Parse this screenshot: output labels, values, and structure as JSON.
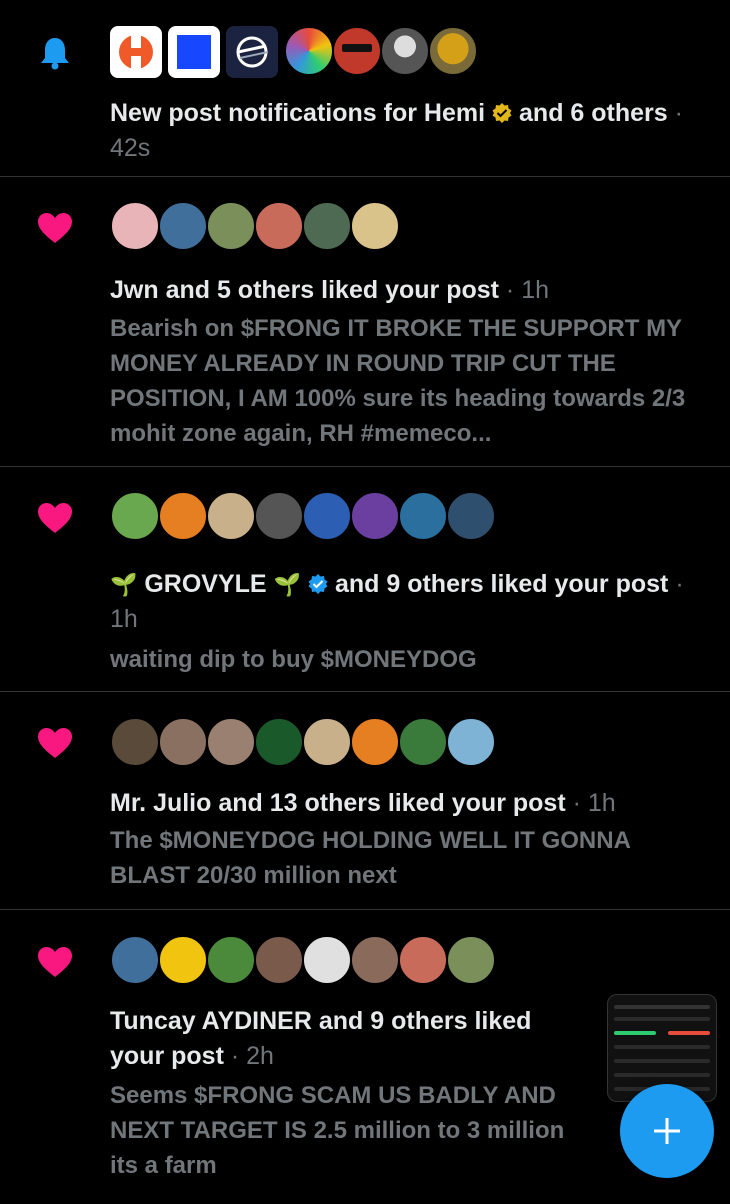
{
  "notifications": [
    {
      "type": "new_post",
      "icon": "bell-icon",
      "text_before": "New post notifications for Hemi",
      "text_after": "and 6 others",
      "time": "42s",
      "avatar_colors": [
        "#f05a28",
        "#1747ff",
        "#1c2340",
        "#9b4dca",
        "#c0392b",
        "#555555",
        "#d4a017"
      ]
    },
    {
      "type": "like",
      "icon": "heart-icon",
      "title": "Jwn and 5 others liked your post",
      "time": "1h",
      "body": "Bearish on $FRONG IT BROKE THE SUPPORT MY MONEY ALREADY IN ROUND TRIP CUT THE POSITION, I AM 100% sure its heading towards 2/3 mohit zone again, RH #memeco...",
      "avatar_colors": [
        "#e8b4b8",
        "#3f6f9a",
        "#7a8f5a",
        "#c96b5a",
        "#4f6a52",
        "#d9c38a"
      ]
    },
    {
      "type": "like",
      "icon": "heart-icon",
      "name": "GROVYLE",
      "title_after": "and 9 others liked your post",
      "time": "1h",
      "body": "waiting dip to buy $MONEYDOG",
      "avatar_colors": [
        "#6aa84f",
        "#e67e22",
        "#c8b08a",
        "#555555",
        "#2c5fb3",
        "#6b3fa0",
        "#2a6f9e",
        "#2f4f6f"
      ]
    },
    {
      "type": "like",
      "icon": "heart-icon",
      "title": "Mr. Julio and 13 others liked your post",
      "time": "1h",
      "body": "The  $MONEYDOG HOLDING WELL IT GONNA BLAST 20/30 million next",
      "avatar_colors": [
        "#5a4a3a",
        "#8a7060",
        "#9a8070",
        "#1a5a2a",
        "#c8b08a",
        "#e67e22",
        "#3a7a3a",
        "#7fb3d5"
      ]
    },
    {
      "type": "like",
      "icon": "heart-icon",
      "title": "Tuncay AYDINER and 9 others liked your post",
      "time": "2h",
      "body": "Seems $FRONG SCAM US BADLY AND NEXT TARGET IS 2.5 million to 3 million its a farm",
      "avatar_colors": [
        "#3f6f9a",
        "#f1c40f",
        "#4a8a3a",
        "#7a5a4a",
        "#e0e0e0",
        "#8a6a5a",
        "#c96b5a",
        "#7a8f5a"
      ]
    }
  ],
  "compose_button": {
    "icon": "plus-icon"
  },
  "thumbnail": {
    "icon": "chart-thumbnail-icon"
  }
}
